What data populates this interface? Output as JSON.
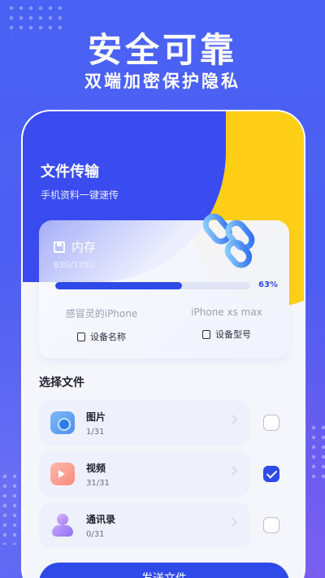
{
  "hero": {
    "title": "安全可靠",
    "subtitle": "双端加密保护隐私"
  },
  "header": {
    "title": "文件传输",
    "subtitle": "手机资料一键速传"
  },
  "storage": {
    "label": "内存",
    "amount": "83G/128G",
    "progress_percent": 65,
    "percent_label": "63%",
    "devices": [
      {
        "value": "感冒灵的iPhone",
        "label": "设备名称",
        "icon": "device-name-icon"
      },
      {
        "value": "iPhone xs max",
        "label": "设备型号",
        "icon": "device-model-icon"
      }
    ]
  },
  "files": {
    "section_title": "选择文件",
    "items": [
      {
        "name": "图片",
        "count": "1/31",
        "icon": "photo-icon",
        "checked": false
      },
      {
        "name": "视频",
        "count": "31/31",
        "icon": "video-icon",
        "checked": true
      },
      {
        "name": "通讯录",
        "count": "0/31",
        "icon": "contacts-icon",
        "checked": false
      }
    ]
  },
  "send_button": "发送文件",
  "colors": {
    "accent": "#2f4ae8",
    "yellow": "#ffcf18",
    "background": "#4a5cf0"
  }
}
